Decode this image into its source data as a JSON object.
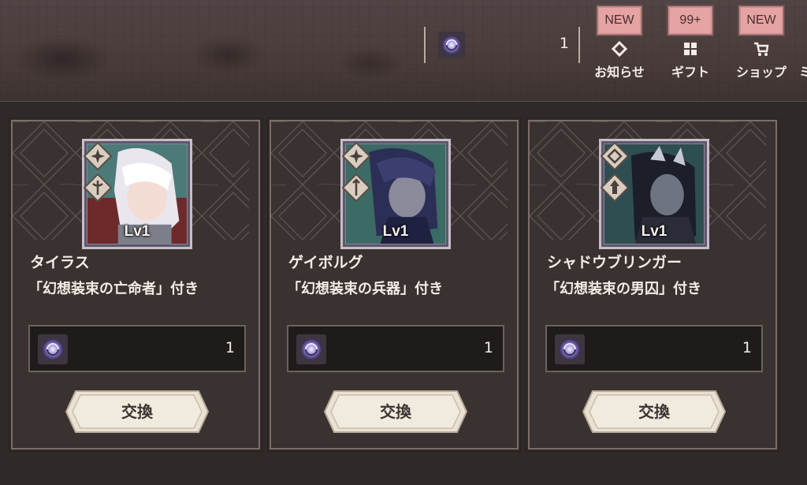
{
  "header": {
    "currency_amount": "1",
    "buttons": [
      {
        "badge": "NEW",
        "label": "お知らせ",
        "icon": "diamond-icon"
      },
      {
        "badge": "99+",
        "label": "ギフト",
        "icon": "grid-icon"
      },
      {
        "badge": "NEW",
        "label": "ショップ",
        "icon": "cart-icon"
      },
      {
        "label": "ミ"
      }
    ]
  },
  "cards": [
    {
      "name": "タイラス",
      "subtitle": "「幻想装束の亡命者」付き",
      "level": "Lv1",
      "cost": "1",
      "button": "交換"
    },
    {
      "name": "ゲイボルグ",
      "subtitle": "「幻想装束の兵器」付き",
      "level": "Lv1",
      "cost": "1",
      "button": "交換"
    },
    {
      "name": "シャドウブリンガー",
      "subtitle": "「幻想装束の男囚」付き",
      "level": "Lv1",
      "cost": "1",
      "button": "交換"
    }
  ],
  "colors": {
    "badge": "#e6a3a3",
    "card_bg": "#393231",
    "button": "#efe8dc",
    "currency_orb": "#8c7fb8"
  }
}
